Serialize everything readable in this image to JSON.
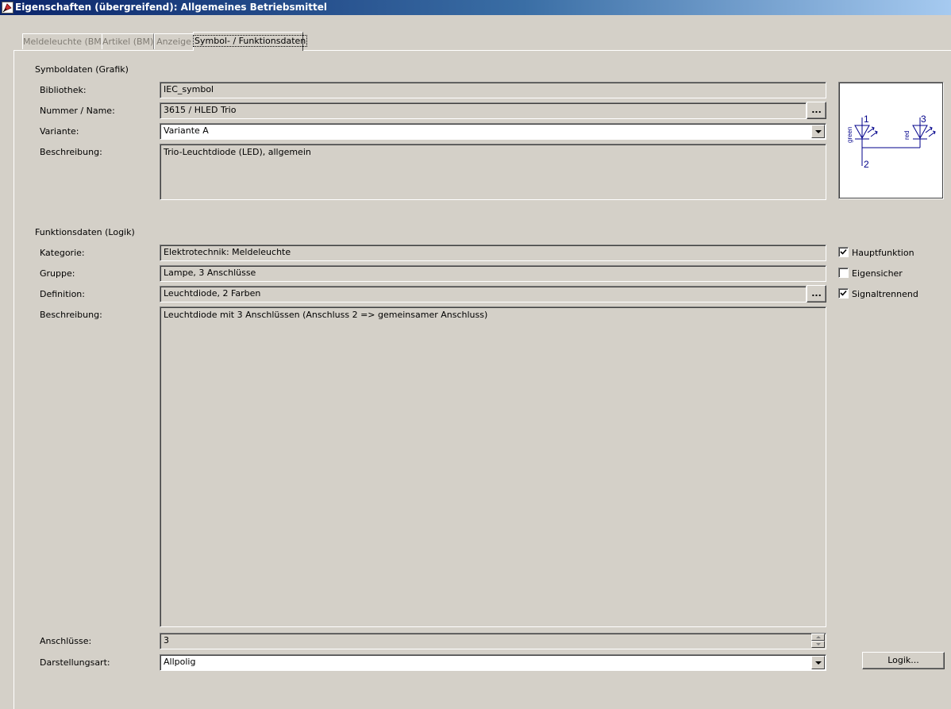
{
  "window": {
    "title": "Eigenschaften (übergreifend): Allgemeines Betriebsmittel"
  },
  "tabs": [
    {
      "label": "Meldeleuchte (BM)",
      "active": false
    },
    {
      "label": "Artikel (BM)",
      "active": false
    },
    {
      "label": "Anzeige",
      "active": false
    },
    {
      "label": "Symbol- / Funktionsdaten",
      "active": true
    }
  ],
  "symbol": {
    "group_title": "Symboldaten (Grafik)",
    "bibliothek_label": "Bibliothek:",
    "bibliothek_value": "IEC_symbol",
    "nummer_label": "Nummer / Name:",
    "nummer_value": "3615 / HLED Trio",
    "browse_label": "...",
    "variante_label": "Variante:",
    "variante_value": "Variante A",
    "beschreibung_label": "Beschreibung:",
    "beschreibung_value": "Trio-Leuchtdiode (LED), allgemein",
    "preview": {
      "pin1": "1",
      "pin2": "2",
      "pin3": "3",
      "color_left": "green",
      "color_right": "red",
      "stroke_color": "#00008b"
    }
  },
  "function": {
    "group_title": "Funktionsdaten (Logik)",
    "kategorie_label": "Kategorie:",
    "kategorie_value": "Elektrotechnik: Meldeleuchte",
    "gruppe_label": "Gruppe:",
    "gruppe_value": "Lampe, 3 Anschlüsse",
    "definition_label": "Definition:",
    "definition_value": "Leuchtdiode, 2 Farben",
    "browse_label": "...",
    "beschreibung_label": "Beschreibung:",
    "beschreibung_value": "Leuchtdiode mit 3 Anschlüssen (Anschluss 2 => gemeinsamer Anschluss)",
    "anschluesse_label": "Anschlüsse:",
    "anschluesse_value": "3",
    "darstellung_label": "Darstellungsart:",
    "darstellung_value": "Allpolig",
    "logik_button": "Logik...",
    "checkboxes": [
      {
        "label": "Hauptfunktion",
        "checked": true
      },
      {
        "label": "Eigensicher",
        "checked": false
      },
      {
        "label": "Signaltrennend",
        "checked": true
      }
    ]
  }
}
